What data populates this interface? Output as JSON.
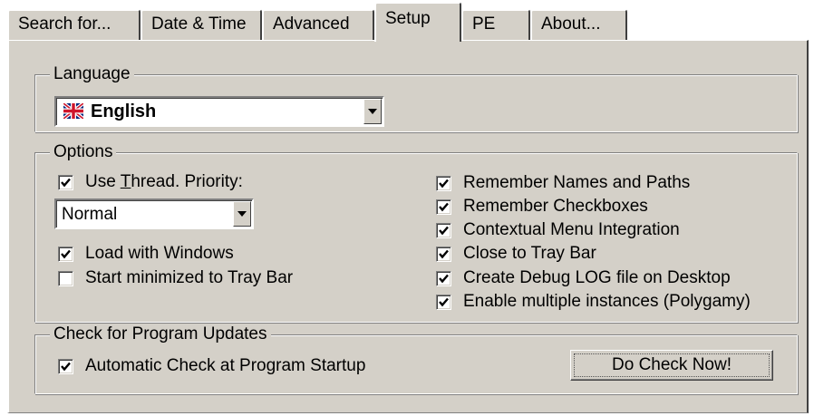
{
  "tabs": [
    {
      "label": "Search for..."
    },
    {
      "label": "Date & Time"
    },
    {
      "label": "Advanced"
    },
    {
      "label": "Setup"
    },
    {
      "label": "PE"
    },
    {
      "label": "About..."
    }
  ],
  "active_tab": "Setup",
  "language_group": {
    "legend": "Language",
    "selected": "English",
    "flag_icon": "uk-flag-icon"
  },
  "options_group": {
    "legend": "Options",
    "use_thread_priority": {
      "label_pre": "Use ",
      "label_u": "T",
      "label_post": "hread. Priority:",
      "checked": true
    },
    "priority_select": {
      "selected": "Normal"
    },
    "left_checks": [
      {
        "label": "Load with Windows",
        "checked": true
      },
      {
        "label": "Start minimized to Tray Bar",
        "checked": false
      }
    ],
    "right_checks": [
      {
        "label": "Remember Names and Paths",
        "checked": true
      },
      {
        "label": "Remember Checkboxes",
        "checked": true
      },
      {
        "label": "Contextual Menu Integration",
        "checked": true
      },
      {
        "label": "Close to Tray Bar",
        "checked": true
      },
      {
        "label": "Create Debug LOG file on Desktop",
        "checked": true
      },
      {
        "label": "Enable multiple instances (Polygamy)",
        "checked": true
      }
    ]
  },
  "updates_group": {
    "legend": "Check for Program Updates",
    "auto_check": {
      "label": "Automatic Check at Program Startup",
      "checked": true
    },
    "check_now_label": "Do Check Now!"
  },
  "colors": {
    "face": "#d4d0c8",
    "shadow": "#808080",
    "highlight": "#ffffff"
  }
}
